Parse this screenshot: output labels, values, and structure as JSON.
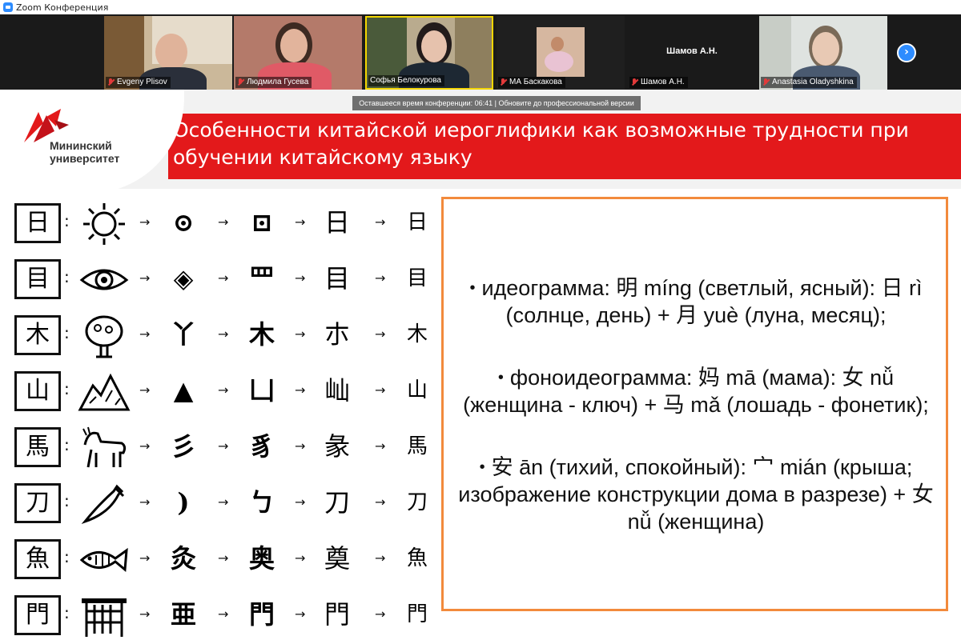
{
  "window": {
    "title": "Zoom Конференция"
  },
  "gallery": {
    "participants": [
      {
        "name": "Evgeny Plisov",
        "muted": true,
        "video": true
      },
      {
        "name": "Людмила Гусева",
        "muted": true,
        "video": true
      },
      {
        "name": "Софья Белокурова",
        "muted": false,
        "video": true
      },
      {
        "name": "МА Баскакова",
        "muted": true,
        "video": true
      },
      {
        "name": "Шамов А.Н.",
        "muted": true,
        "video": false,
        "center_label": "Шамов А.Н."
      },
      {
        "name": "Anastasia Oladyshkina",
        "muted": true,
        "video": true
      }
    ],
    "next_icon": "chevron-right-icon"
  },
  "meeting": {
    "time_banner": "Оставшееся время конференции: 06:41 | Обновите до профессиональной версии"
  },
  "slide": {
    "logo_text": [
      "Мининский",
      "университет"
    ],
    "title": "Особенности китайской иероглифики как возможные трудности при обучении китайскому языку",
    "rows": [
      {
        "char": "日",
        "stages": [
          "⊙",
          "⊡",
          "日",
          "日"
        ]
      },
      {
        "char": "目",
        "stages": [
          "◈",
          "罒",
          "目",
          "目"
        ]
      },
      {
        "char": "木",
        "stages": [
          "丫",
          "木",
          "朩",
          "木"
        ]
      },
      {
        "char": "山",
        "stages": [
          "▲",
          "凵",
          "屾",
          "山"
        ]
      },
      {
        "char": "馬",
        "stages": [
          "彡",
          "豸",
          "彖",
          "馬"
        ]
      },
      {
        "char": "刀",
        "stages": [
          ")",
          "ㄅ",
          "刀",
          "刀"
        ]
      },
      {
        "char": "魚",
        "stages": [
          "灸",
          "奥",
          "奠",
          "魚"
        ]
      },
      {
        "char": "門",
        "stages": [
          "亜",
          "門",
          "門",
          "門"
        ]
      }
    ],
    "arrow": "→",
    "colon": ":",
    "bullets": [
      "идеограмма: 明 míng (светлый, ясный): 日 rì (солнце, день) + 月 yuè (луна, месяц);",
      "фоноидеограмма: 妈 mā (мама): 女 nǚ (женщина - ключ) + 马 mǎ (лошадь - фонетик);",
      "安 ān (тихий, спокойный): 宀 mián (крыша; изображение конструкции дома в разрезе) + 女 nǚ (женщина)"
    ],
    "bullet_glyph": "•"
  },
  "colors": {
    "accent_red": "#e3191b",
    "zoom_blue": "#2d8cff",
    "box_orange": "#f28a3c"
  }
}
